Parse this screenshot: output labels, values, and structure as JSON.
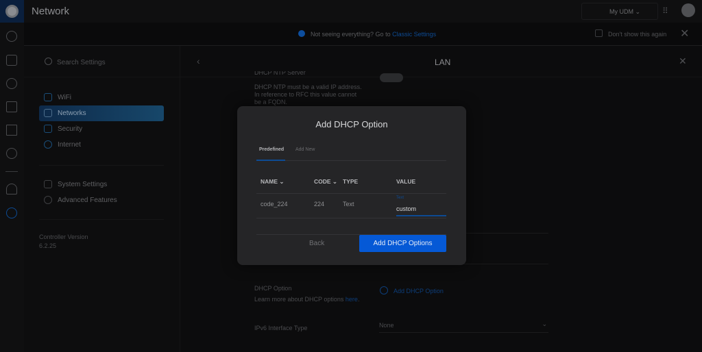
{
  "app": {
    "title": "Network",
    "device": "My UDM"
  },
  "banner": {
    "text": "Not seeing everything? Go to ",
    "link": "Classic Settings",
    "checkbox_label": "Don't show this again"
  },
  "sidebar": {
    "search_placeholder": "Search Settings",
    "items": [
      {
        "label": "WiFi"
      },
      {
        "label": "Networks"
      },
      {
        "label": "Security"
      },
      {
        "label": "Internet"
      },
      {
        "label": "System Settings"
      },
      {
        "label": "Advanced Features"
      }
    ],
    "version_label": "Controller Version",
    "version": "6.2.25"
  },
  "main": {
    "title": "LAN",
    "ntp_title": "DHCP NTP Server",
    "ntp_help": "DHCP NTP must be a valid IP address. In reference to RFC this value cannot be a FQDN.",
    "dhcp_option_label": "DHCP Option",
    "dhcp_help": "Learn more about DHCP options ",
    "dhcp_help_link": "here",
    "dhcp_help_end": ".",
    "add_option": "Add DHCP Option",
    "ipv6_label": "IPv6 Interface Type",
    "ipv6_value": "None"
  },
  "modal": {
    "title": "Add DHCP Option",
    "tabs": [
      "Predefined",
      "Add New"
    ],
    "columns": [
      "NAME",
      "CODE",
      "TYPE",
      "VALUE"
    ],
    "row": {
      "name": "code_224",
      "code": "224",
      "type": "Text",
      "value_label": "Text",
      "value": "custom"
    },
    "back": "Back",
    "submit": "Add DHCP Options"
  },
  "colors": {
    "accent": "#0559d6"
  }
}
